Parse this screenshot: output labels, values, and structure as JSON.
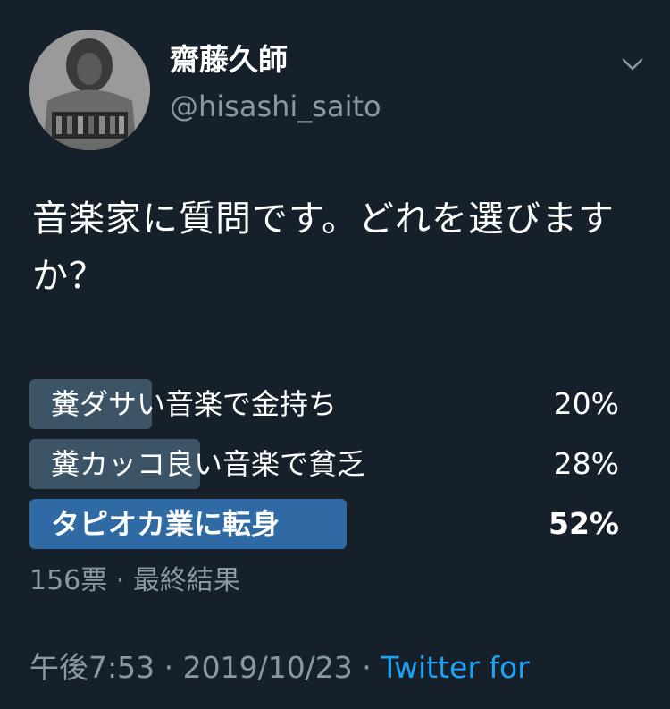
{
  "user": {
    "display_name": "齋藤久師",
    "handle": "@hisashi_saito"
  },
  "tweet": {
    "text": "音楽家に質問です。どれを選びますか？"
  },
  "poll": {
    "options": [
      {
        "label": "糞ダサい音楽で金持ち",
        "percent_label": "20%",
        "percent": 20
      },
      {
        "label": "糞カッコ良い音楽で貧乏",
        "percent_label": "28%",
        "percent": 28
      },
      {
        "label": "タピオカ業に転身",
        "percent_label": "52%",
        "percent": 52
      }
    ],
    "votes": "156票",
    "separator": " · ",
    "status": "最終結果"
  },
  "footer": {
    "time": "午後7:53",
    "date": "2019/10/23",
    "separator": " · ",
    "source": "Twitter for"
  },
  "colors": {
    "background": "#15202b",
    "secondary_text": "#8899a6",
    "poll_bar": "#3d5466",
    "poll_bar_winner": "#2f6aa5",
    "link": "#1da1f2"
  },
  "icons": {
    "avatar": "avatar-photo",
    "menu": "chevron-down-icon"
  }
}
